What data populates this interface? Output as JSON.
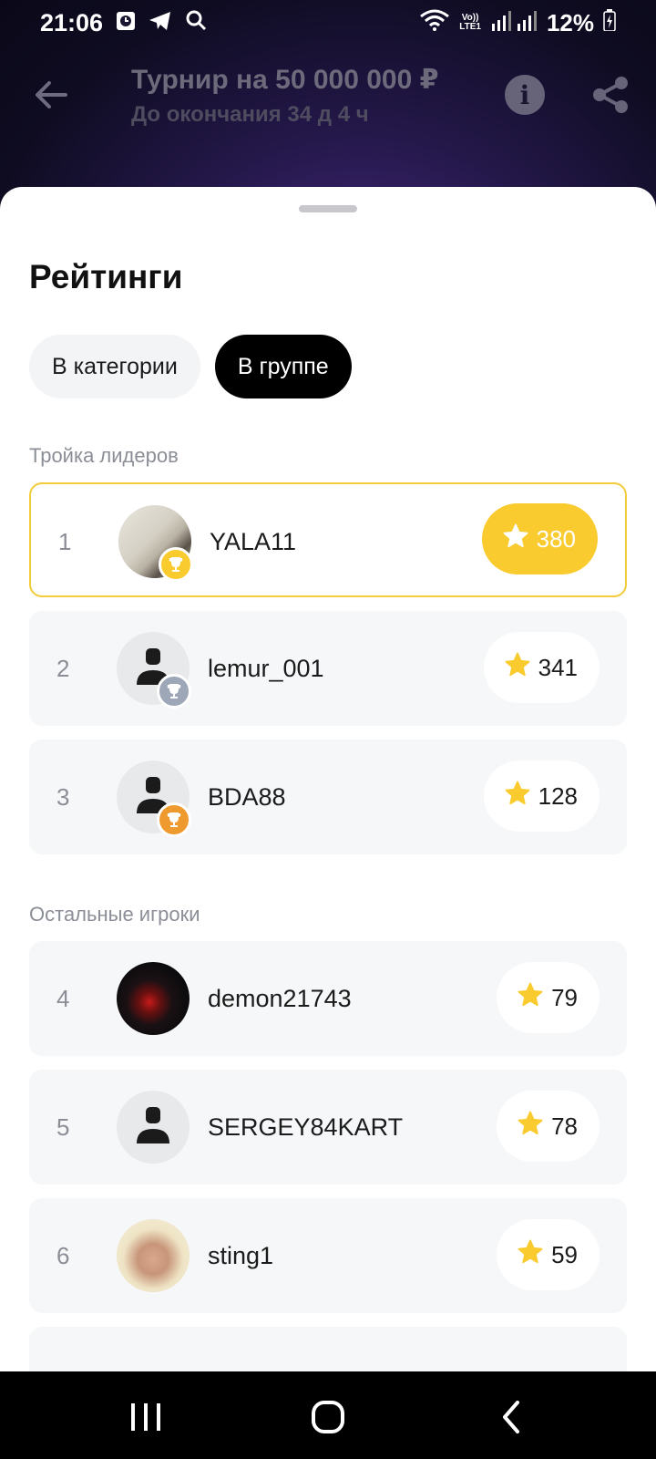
{
  "status_bar": {
    "time": "21:06",
    "battery": "12%",
    "network_label_top": "Vo))",
    "network_label_bottom": "LTE1",
    "icons": [
      "clock-widget-icon",
      "telegram-icon",
      "search-icon",
      "wifi-icon",
      "signal-icon",
      "battery-charging-icon"
    ]
  },
  "header": {
    "title": "Турнир на 50 000 000 ₽",
    "subtitle": "До окончания 34 д 4 ч",
    "info_icon_glyph": "i",
    "icons": [
      "back-arrow-icon",
      "info-icon",
      "share-icon"
    ]
  },
  "sheet": {
    "title": "Рейтинги",
    "tabs": [
      {
        "label": "В категории",
        "active": false
      },
      {
        "label": "В группе",
        "active": true
      }
    ],
    "leaders_label": "Тройка лидеров",
    "others_label": "Остальные игроки",
    "leaders": [
      {
        "rank": "1",
        "name": "YALA11",
        "score": "380",
        "trophy": "gold",
        "avatar": "photo"
      },
      {
        "rank": "2",
        "name": "lemur_001",
        "score": "341",
        "trophy": "silver",
        "avatar": "placeholder"
      },
      {
        "rank": "3",
        "name": "BDA88",
        "score": "128",
        "trophy": "bronze",
        "avatar": "placeholder"
      }
    ],
    "others": [
      {
        "rank": "4",
        "name": "demon21743",
        "score": "79",
        "avatar": "photo-car"
      },
      {
        "rank": "5",
        "name": "SERGEY84KART",
        "score": "78",
        "avatar": "placeholder"
      },
      {
        "rank": "6",
        "name": "sting1",
        "score": "59",
        "avatar": "photo-face"
      }
    ]
  },
  "colors": {
    "accent_gold": "#f9cb2f",
    "leader_border": "#f3cc3c",
    "star": "#f9cb2f",
    "trophy_silver": "#9ea7b8",
    "trophy_bronze": "#ef9a2e",
    "active_tab": "#000000"
  },
  "nav_bar": {
    "icons": [
      "recent-apps-icon",
      "home-icon",
      "back-icon"
    ]
  }
}
